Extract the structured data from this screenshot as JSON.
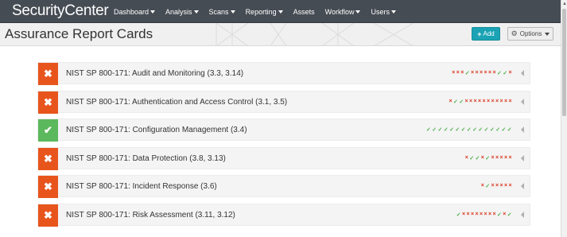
{
  "app": {
    "brand": "SecurityCenter"
  },
  "nav": [
    {
      "label": "Dashboard",
      "dropdown": true
    },
    {
      "label": "Analysis",
      "dropdown": true
    },
    {
      "label": "Scans",
      "dropdown": true
    },
    {
      "label": "Reporting",
      "dropdown": true
    },
    {
      "label": "Assets",
      "dropdown": false
    },
    {
      "label": "Workflow",
      "dropdown": true
    },
    {
      "label": "Users",
      "dropdown": true
    }
  ],
  "header": {
    "title": "Assurance Report Cards",
    "add_label": "Add",
    "options_label": "Options"
  },
  "colors": {
    "fail": "#e8551c",
    "pass": "#5cb85c",
    "accent": "#1aa3b4",
    "topbar": "#464c54"
  },
  "cards": [
    {
      "label": "NIST SP 800-171: Audit and Monitoring (3.3, 3.14)",
      "status": "fail",
      "marks": "xxx✓xxxxxx✓✓x"
    },
    {
      "label": "NIST SP 800-171: Authentication and Access Control (3.1, 3.5)",
      "status": "fail",
      "marks": "x✓✓xxxxxxxxxxx"
    },
    {
      "label": "NIST SP 800-171: Configuration Management (3.4)",
      "status": "pass",
      "marks": "✓✓✓✓✓✓✓✓✓✓✓✓✓✓✓"
    },
    {
      "label": "NIST SP 800-171: Data Protection (3.8, 3.13)",
      "status": "fail",
      "marks": "x✓✓x✓xxxxx"
    },
    {
      "label": "NIST SP 800-171: Incident Response (3.6)",
      "status": "fail",
      "marks": "x✓xxxxx"
    },
    {
      "label": "NIST SP 800-171: Risk Assessment (3.11, 3.12)",
      "status": "fail",
      "marks": "✓xxxxxxxx✓x✓"
    }
  ]
}
